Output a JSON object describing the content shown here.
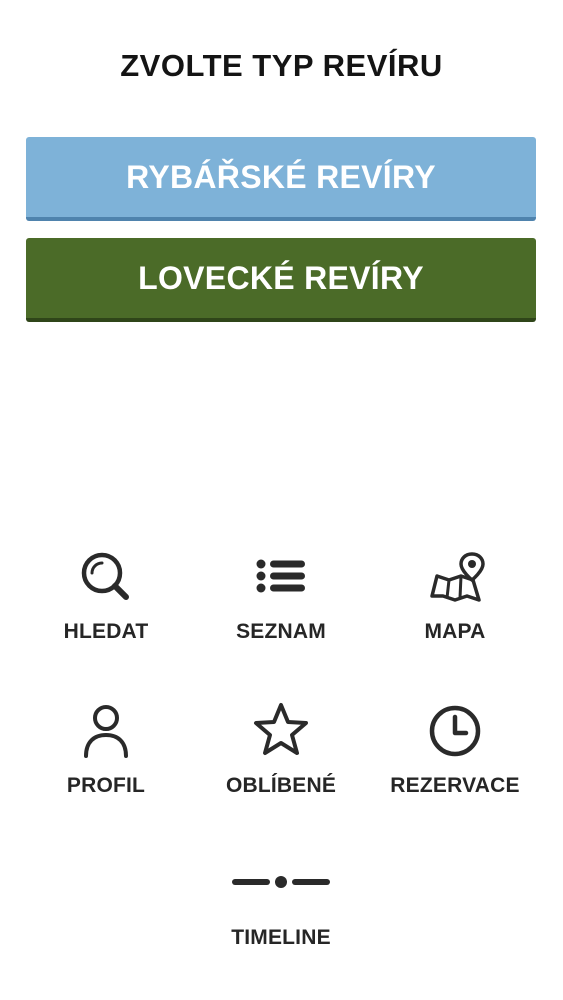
{
  "header": {
    "title": "ZVOLTE TYP REVÍRU"
  },
  "type_buttons": [
    {
      "label": "RYBÁŘSKÉ REVÍRY",
      "color": "#7eb2d8"
    },
    {
      "label": "LOVECKÉ REVÍRY",
      "color": "#4b6b28"
    }
  ],
  "nav": {
    "items": [
      {
        "label": "HLEDAT",
        "icon": "search-icon"
      },
      {
        "label": "SEZNAM",
        "icon": "list-icon"
      },
      {
        "label": "MAPA",
        "icon": "map-icon"
      },
      {
        "label": "PROFIL",
        "icon": "user-icon"
      },
      {
        "label": "OBLÍBENÉ",
        "icon": "star-icon"
      },
      {
        "label": "REZERVACE",
        "icon": "clock-icon"
      },
      {
        "label": "TIMELINE",
        "icon": "timeline-icon"
      }
    ]
  }
}
